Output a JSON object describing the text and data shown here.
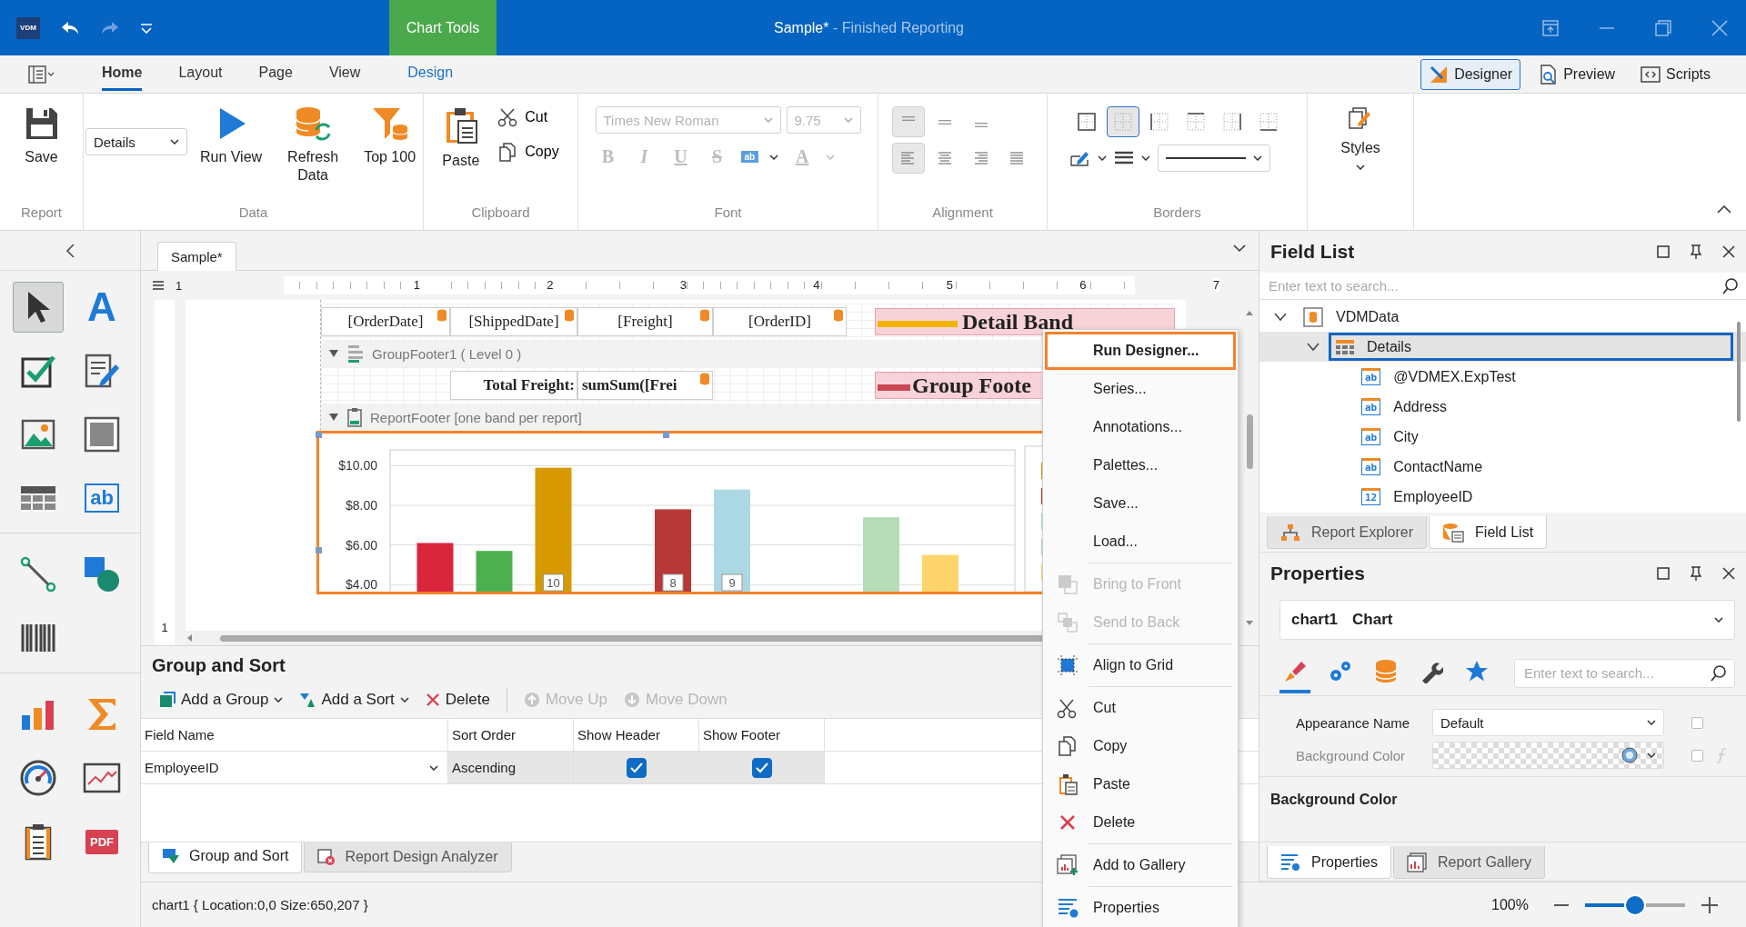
{
  "title_bar": {
    "logo": "VDM",
    "context_tab": "Chart Tools",
    "document": "Sample*",
    "app": "- Finished Reporting"
  },
  "ribbon_tabs": [
    {
      "label": "Home",
      "selected": true,
      "kind": "main"
    },
    {
      "label": "Layout",
      "selected": false,
      "kind": "main"
    },
    {
      "label": "Page",
      "selected": false,
      "kind": "main"
    },
    {
      "label": "View",
      "selected": false,
      "kind": "main"
    },
    {
      "label": "Design",
      "selected": false,
      "kind": "contextual"
    }
  ],
  "view_buttons": [
    {
      "label": "Designer",
      "selected": true
    },
    {
      "label": "Preview",
      "selected": false
    },
    {
      "label": "Scripts",
      "selected": false
    }
  ],
  "ribbon": {
    "report": {
      "caption": "Report",
      "save": "Save"
    },
    "data": {
      "caption": "Data",
      "view_combo": "Details",
      "run_view": "Run View",
      "refresh_data": "Refresh Data",
      "top": "Top 100"
    },
    "clipboard": {
      "caption": "Clipboard",
      "paste": "Paste",
      "cut": "Cut",
      "copy": "Copy"
    },
    "font": {
      "caption": "Font",
      "disabled": true,
      "font_name": "Times New Roman",
      "font_size": "9.75",
      "styles": [
        "B",
        "I",
        "U",
        "S"
      ],
      "highlight": "ab",
      "font_color_button": "A"
    },
    "alignment": {
      "caption": "Alignment",
      "vertical": [
        {
          "selected": true
        },
        {
          "selected": false
        },
        {
          "selected": false
        }
      ],
      "horizontal": [
        {
          "selected": true
        },
        {
          "selected": false
        },
        {
          "selected": false
        },
        {
          "selected": false
        }
      ]
    },
    "borders": {
      "caption": "Borders",
      "sides": [
        {
          "selected": false
        },
        {
          "selected": true
        },
        {
          "selected": false
        },
        {
          "selected": false
        },
        {
          "selected": false
        },
        {
          "selected": false
        }
      ]
    },
    "styles": {
      "label": "Styles"
    }
  },
  "toolbox": [
    {
      "selected": true
    },
    {
      "selected": false,
      "glyph": "A"
    },
    {
      "selected": false
    },
    {
      "selected": false
    },
    {
      "selected": false
    },
    {
      "selected": false
    },
    {
      "selected": false
    },
    {
      "selected": false,
      "glyph": "ab"
    },
    {
      "selected": false
    },
    {
      "selected": false
    },
    {
      "selected": false
    },
    {
      "selected": false
    },
    {
      "selected": false
    },
    {
      "selected": false
    },
    {
      "selected": false
    },
    {
      "selected": false
    },
    {
      "selected": false,
      "glyph": "PDF"
    }
  ],
  "document_tabs": [
    {
      "label": "Sample*",
      "selected": true
    }
  ],
  "ruler": {
    "origin": "1",
    "marks": [
      "1",
      "2",
      "3",
      "4",
      "5",
      "6",
      "7"
    ],
    "vertical": [
      "1"
    ]
  },
  "report": {
    "detail_cells": [
      "[OrderDate]",
      "[ShippedDate]",
      "[Freight]",
      "[OrderID]"
    ],
    "detail_label": "Detail Band",
    "group_footer": {
      "expanded": true,
      "title": "GroupFooter1 ( Level 0 )"
    },
    "total_cells": [
      "Total Freight:",
      "sumSum([Frei"
    ],
    "group_footer_label": "Group Foote",
    "report_footer": {
      "expanded": true,
      "title": "ReportFooter [one band per report]"
    },
    "chart": {
      "chart_data": {
        "type": "bar",
        "grid": true,
        "ylim": [
          3.6,
          10.8
        ],
        "yticks": [
          {
            "value": 4,
            "label": "$4.00"
          },
          {
            "value": 6,
            "label": "$6.00"
          },
          {
            "value": 8,
            "label": "$8.00"
          },
          {
            "value": 10,
            "label": "$10.00"
          }
        ],
        "series": [
          {
            "color": "#d9263c",
            "values": [
              6.1,
              null,
              null
            ]
          },
          {
            "color": "#4caf50",
            "values": [
              5.7,
              null,
              null
            ]
          },
          {
            "color": "#d69a00",
            "values": [
              9.9,
              null,
              null
            ]
          },
          {
            "color": "#b83838",
            "values": [
              null,
              7.8,
              null
            ]
          },
          {
            "color": "#acd8e3",
            "values": [
              null,
              8.8,
              null
            ]
          },
          {
            "color": "#b5dcb6",
            "values": [
              null,
              null,
              7.4
            ]
          },
          {
            "color": "#fdd56a",
            "values": [
              null,
              null,
              5.5
            ]
          }
        ],
        "annotations": [
          "10",
          "8",
          "9"
        ]
      }
    }
  },
  "context_menu": [
    {
      "label": "Run Designer...",
      "highlighted": true,
      "disabled": false
    },
    {
      "label": "Series...",
      "highlighted": false,
      "disabled": false
    },
    {
      "label": "Annotations...",
      "highlighted": false,
      "disabled": false
    },
    {
      "label": "Palettes...",
      "highlighted": false,
      "disabled": false
    },
    {
      "label": "Save...",
      "highlighted": false,
      "disabled": false
    },
    {
      "label": "Load...",
      "highlighted": false,
      "disabled": false
    },
    {
      "label": "Bring to Front",
      "highlighted": false,
      "disabled": true,
      "separator_before": true
    },
    {
      "label": "Send to Back",
      "highlighted": false,
      "disabled": true
    },
    {
      "label": "Align to Grid",
      "highlighted": false,
      "disabled": false,
      "separator_before": true
    },
    {
      "label": "Cut",
      "highlighted": false,
      "disabled": false,
      "separator_before": true
    },
    {
      "label": "Copy",
      "highlighted": false,
      "disabled": false
    },
    {
      "label": "Paste",
      "highlighted": false,
      "disabled": false
    },
    {
      "label": "Delete",
      "highlighted": false,
      "disabled": false
    },
    {
      "label": "Add to Gallery",
      "highlighted": false,
      "disabled": false,
      "separator_before": true
    },
    {
      "label": "Properties",
      "highlighted": false,
      "disabled": false,
      "separator_before": true
    }
  ],
  "group_and_sort": {
    "title": "Group and Sort",
    "toolbar": [
      {
        "label": "Add a Group",
        "disabled": false,
        "dropdown": true
      },
      {
        "label": "Add a Sort",
        "disabled": false,
        "dropdown": true
      },
      {
        "label": "Delete",
        "disabled": false,
        "dropdown": false
      },
      {
        "label": "Move Up",
        "disabled": true,
        "dropdown": false
      },
      {
        "label": "Move Down",
        "disabled": true,
        "dropdown": false
      }
    ],
    "columns": [
      "Field Name",
      "Sort Order",
      "Show Header",
      "Show Footer"
    ],
    "rows": [
      {
        "field_name": "EmployeeID",
        "sort_order": "Ascending",
        "show_header": true,
        "show_footer": true
      }
    ]
  },
  "designer_tabs": [
    {
      "label": "Group and Sort",
      "selected": true
    },
    {
      "label": "Report Design Analyzer",
      "selected": false
    }
  ],
  "field_list": {
    "title": "Field List",
    "search": {
      "placeholder": "Enter text to search..."
    },
    "tree": [
      {
        "label": "VDMData",
        "expanded": true,
        "selected": false,
        "children": [
          {
            "label": "Details",
            "expanded": true,
            "selected": true,
            "children": [
              {
                "label": "@VDMEX.ExpTest",
                "type": "ab",
                "selected": false
              },
              {
                "label": "Address",
                "type": "ab",
                "selected": false
              },
              {
                "label": "City",
                "type": "ab",
                "selected": false
              },
              {
                "label": "ContactName",
                "type": "ab",
                "selected": false
              },
              {
                "label": "EmployeeID",
                "type": "12",
                "selected": false
              }
            ]
          }
        ]
      }
    ],
    "tabs": [
      {
        "label": "Report Explorer",
        "selected": false
      },
      {
        "label": "Field List",
        "selected": true
      }
    ]
  },
  "properties": {
    "title": "Properties",
    "object_name": "chart1",
    "object_type": "Chart",
    "categories": [
      {
        "selected": true
      },
      {
        "selected": false
      },
      {
        "selected": false
      },
      {
        "selected": false
      },
      {
        "selected": false
      }
    ],
    "search": {
      "placeholder": "Enter text to search..."
    },
    "rows": [
      {
        "label": "Appearance Name",
        "value": "Default",
        "kind": "combo",
        "disabled": false
      },
      {
        "label": "Background Color",
        "kind": "color",
        "disabled": true
      }
    ],
    "description_title": "Background Color",
    "tabs": [
      {
        "label": "Properties",
        "selected": true
      },
      {
        "label": "Report Gallery",
        "selected": false
      }
    ]
  },
  "status_bar": {
    "text": "chart1 { Location:0,0 Size:650,207 }",
    "zoom": "100%",
    "zoom_slider": {
      "level": 0.5
    }
  }
}
